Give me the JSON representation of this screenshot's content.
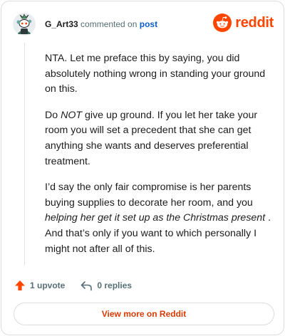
{
  "header": {
    "username": "G_Art33",
    "action_text": "commented on",
    "link_text": "post",
    "brand_name": "reddit",
    "avatar_icon": "snoo-avatar-icon",
    "brand_icon": "reddit-logo-icon"
  },
  "comment": {
    "paragraphs": [
      {
        "segments": [
          {
            "text": "NTA. Let me preface this by saying, you did absolutely nothing wrong in standing your ground on this.",
            "italic": false
          }
        ]
      },
      {
        "segments": [
          {
            "text": "Do ",
            "italic": false
          },
          {
            "text": "NOT",
            "italic": true
          },
          {
            "text": " give up ground. If you let her take your room you will set a precedent that she can get anything she wants and deserves preferential treatment.",
            "italic": false
          }
        ]
      },
      {
        "segments": [
          {
            "text": "I’d say the only fair compromise is her parents buying supplies to decorate her room, and you ",
            "italic": false
          },
          {
            "text": "helping her get it set up as the Christmas present",
            "italic": true
          },
          {
            "text": " . And that’s only if you want to which personally I might not after all of this.",
            "italic": false
          }
        ]
      }
    ]
  },
  "actions": {
    "upvote_label": "1 upvote",
    "replies_label": "0 replies",
    "upvote_icon": "upvote-arrow-icon",
    "reply_icon": "reply-arrow-icon"
  },
  "footer": {
    "view_more_label": "View more on Reddit"
  },
  "colors": {
    "brand": "#ff4500",
    "link": "#0a5ec2",
    "muted": "#576f76",
    "button_text": "#d93a00"
  }
}
